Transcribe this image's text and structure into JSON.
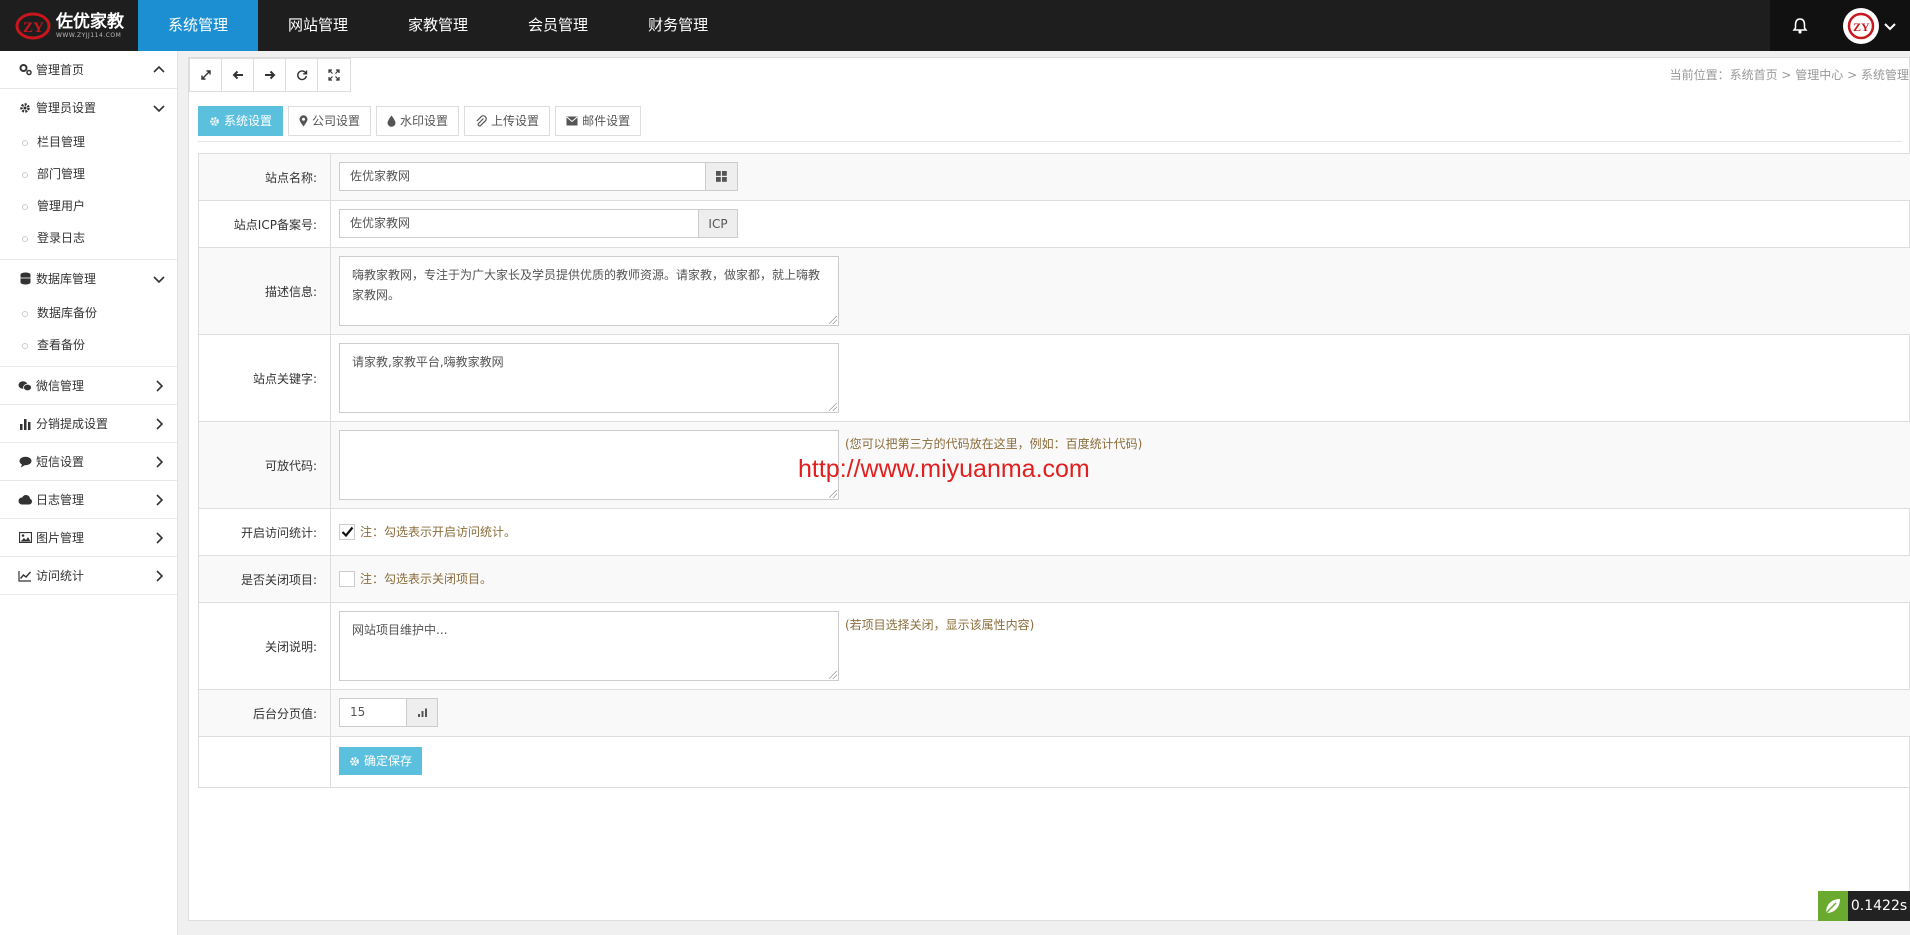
{
  "brand": {
    "title": "佐优家教",
    "subtitle": "WWW.ZYJJ114.COM"
  },
  "nav": [
    {
      "label": "系统管理",
      "active": true
    },
    {
      "label": "网站管理"
    },
    {
      "label": "家教管理"
    },
    {
      "label": "会员管理"
    },
    {
      "label": "财务管理"
    }
  ],
  "sidebar": {
    "home": "管理首页",
    "admin": {
      "label": "管理员设置",
      "items": [
        "栏目管理",
        "部门管理",
        "管理用户",
        "登录日志"
      ]
    },
    "db": {
      "label": "数据库管理",
      "items": [
        "数据库备份",
        "查看备份"
      ]
    },
    "groups": [
      "微信管理",
      "分销提成设置",
      "短信设置",
      "日志管理",
      "图片管理",
      "访问统计"
    ]
  },
  "breadcrumb": {
    "prefix": "当前位置：",
    "items": [
      "系统首页",
      "管理中心",
      "系统管理"
    ]
  },
  "tabs": [
    "系统设置",
    "公司设置",
    "水印设置",
    "上传设置",
    "邮件设置"
  ],
  "form": {
    "site_name": {
      "label": "站点名称:",
      "value": "佐优家教网"
    },
    "icp": {
      "label": "站点ICP备案号:",
      "value": "佐优家教网",
      "addon": "ICP"
    },
    "description": {
      "label": "描述信息:",
      "value": "嗨教家教网，专注于为广大家长及学员提供优质的教师资源。请家教，做家都，就上嗨教家教网。"
    },
    "keywords": {
      "label": "站点关键字:",
      "value": "请家教,家教平台,嗨教家教网"
    },
    "code": {
      "label": "可放代码:",
      "value": "",
      "hint": "(您可以把第三方的代码放在这里，例如：百度统计代码)"
    },
    "stats": {
      "label": "开启访问统计:",
      "checked": true,
      "note": "注：勾选表示开启访问统计。"
    },
    "close": {
      "label": "是否关闭项目:",
      "checked": false,
      "note": "注：勾选表示关闭项目。"
    },
    "close_msg": {
      "label": "关闭说明:",
      "value": "网站项目维护中...",
      "hint": "(若项目选择关闭，显示该属性内容)"
    },
    "page_size": {
      "label": "后台分页值:",
      "value": "15"
    },
    "save": "确定保存"
  },
  "watermark": "http://www.miyuanma.com",
  "timer": "0.1422s",
  "colors": {
    "nav_active": "#1b8fd1",
    "tab_active": "#5bc0de",
    "topbar": "#1e1e1e"
  }
}
